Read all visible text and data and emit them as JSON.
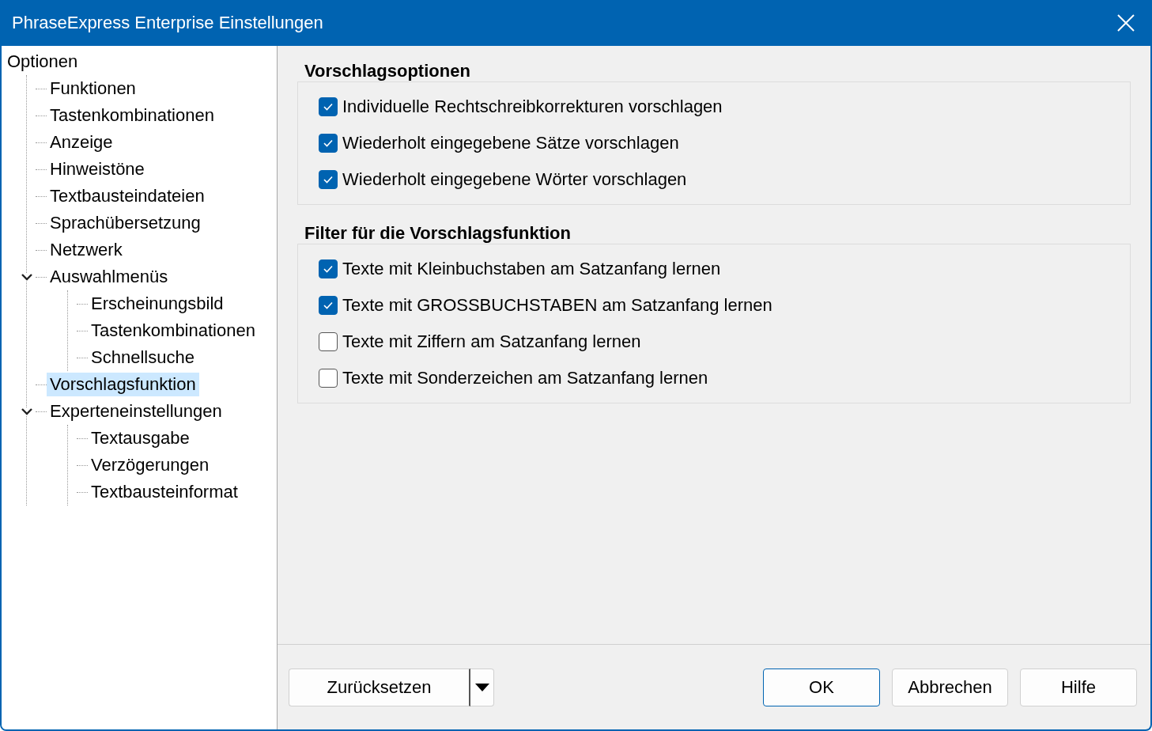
{
  "window": {
    "title": "PhraseExpress Enterprise Einstellungen"
  },
  "tree": [
    {
      "label": "Optionen",
      "selected": false,
      "children": [
        {
          "label": "Funktionen",
          "selected": false
        },
        {
          "label": "Tastenkombinationen",
          "selected": false
        },
        {
          "label": "Anzeige",
          "selected": false
        },
        {
          "label": "Hinweistöne",
          "selected": false
        },
        {
          "label": "Textbausteindateien",
          "selected": false
        },
        {
          "label": "Sprachübersetzung",
          "selected": false
        },
        {
          "label": "Netzwerk",
          "selected": false
        },
        {
          "label": "Auswahlmenüs",
          "selected": false,
          "expanded": true,
          "children": [
            {
              "label": "Erscheinungsbild",
              "selected": false
            },
            {
              "label": "Tastenkombinationen",
              "selected": false
            },
            {
              "label": "Schnellsuche",
              "selected": false
            }
          ]
        },
        {
          "label": "Vorschlagsfunktion",
          "selected": true
        },
        {
          "label": "Experteneinstellungen",
          "selected": false,
          "expanded": true,
          "children": [
            {
              "label": "Textausgabe",
              "selected": false
            },
            {
              "label": "Verzögerungen",
              "selected": false
            },
            {
              "label": "Textbausteinformat",
              "selected": false
            }
          ]
        }
      ]
    }
  ],
  "groups": [
    {
      "title": "Vorschlagsoptionen",
      "options": [
        {
          "label": "Individuelle Rechtschreibkorrekturen vorschlagen",
          "checked": true
        },
        {
          "label": "Wiederholt eingegebene Sätze vorschlagen",
          "checked": true
        },
        {
          "label": "Wiederholt eingegebene Wörter vorschlagen",
          "checked": true
        }
      ]
    },
    {
      "title": "Filter für die Vorschlagsfunktion",
      "options": [
        {
          "label": "Texte mit Kleinbuchstaben am Satzanfang lernen",
          "checked": true
        },
        {
          "label": "Texte mit GROSSBUCHSTABEN am Satzanfang lernen",
          "checked": true
        },
        {
          "label": "Texte mit Ziffern am Satzanfang lernen",
          "checked": false
        },
        {
          "label": "Texte mit Sonderzeichen am Satzanfang lernen",
          "checked": false
        }
      ]
    }
  ],
  "buttons": [
    {
      "label": "Zurücksetzen",
      "kind": "split",
      "default": false
    },
    {
      "label": "OK",
      "kind": "plain",
      "default": true
    },
    {
      "label": "Abbrechen",
      "kind": "plain",
      "default": false
    },
    {
      "label": "Hilfe",
      "kind": "plain",
      "default": false
    }
  ]
}
